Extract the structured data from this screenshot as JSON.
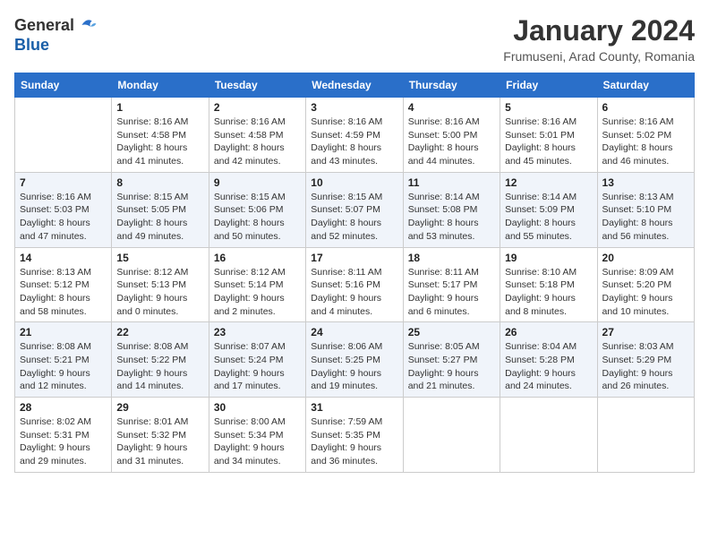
{
  "logo": {
    "text_general": "General",
    "text_blue": "Blue"
  },
  "title": "January 2024",
  "subtitle": "Frumuseni, Arad County, Romania",
  "headers": [
    "Sunday",
    "Monday",
    "Tuesday",
    "Wednesday",
    "Thursday",
    "Friday",
    "Saturday"
  ],
  "weeks": [
    [
      {
        "day": "",
        "info": ""
      },
      {
        "day": "1",
        "info": "Sunrise: 8:16 AM\nSunset: 4:58 PM\nDaylight: 8 hours\nand 41 minutes."
      },
      {
        "day": "2",
        "info": "Sunrise: 8:16 AM\nSunset: 4:58 PM\nDaylight: 8 hours\nand 42 minutes."
      },
      {
        "day": "3",
        "info": "Sunrise: 8:16 AM\nSunset: 4:59 PM\nDaylight: 8 hours\nand 43 minutes."
      },
      {
        "day": "4",
        "info": "Sunrise: 8:16 AM\nSunset: 5:00 PM\nDaylight: 8 hours\nand 44 minutes."
      },
      {
        "day": "5",
        "info": "Sunrise: 8:16 AM\nSunset: 5:01 PM\nDaylight: 8 hours\nand 45 minutes."
      },
      {
        "day": "6",
        "info": "Sunrise: 8:16 AM\nSunset: 5:02 PM\nDaylight: 8 hours\nand 46 minutes."
      }
    ],
    [
      {
        "day": "7",
        "info": "Sunrise: 8:16 AM\nSunset: 5:03 PM\nDaylight: 8 hours\nand 47 minutes."
      },
      {
        "day": "8",
        "info": "Sunrise: 8:15 AM\nSunset: 5:05 PM\nDaylight: 8 hours\nand 49 minutes."
      },
      {
        "day": "9",
        "info": "Sunrise: 8:15 AM\nSunset: 5:06 PM\nDaylight: 8 hours\nand 50 minutes."
      },
      {
        "day": "10",
        "info": "Sunrise: 8:15 AM\nSunset: 5:07 PM\nDaylight: 8 hours\nand 52 minutes."
      },
      {
        "day": "11",
        "info": "Sunrise: 8:14 AM\nSunset: 5:08 PM\nDaylight: 8 hours\nand 53 minutes."
      },
      {
        "day": "12",
        "info": "Sunrise: 8:14 AM\nSunset: 5:09 PM\nDaylight: 8 hours\nand 55 minutes."
      },
      {
        "day": "13",
        "info": "Sunrise: 8:13 AM\nSunset: 5:10 PM\nDaylight: 8 hours\nand 56 minutes."
      }
    ],
    [
      {
        "day": "14",
        "info": "Sunrise: 8:13 AM\nSunset: 5:12 PM\nDaylight: 8 hours\nand 58 minutes."
      },
      {
        "day": "15",
        "info": "Sunrise: 8:12 AM\nSunset: 5:13 PM\nDaylight: 9 hours\nand 0 minutes."
      },
      {
        "day": "16",
        "info": "Sunrise: 8:12 AM\nSunset: 5:14 PM\nDaylight: 9 hours\nand 2 minutes."
      },
      {
        "day": "17",
        "info": "Sunrise: 8:11 AM\nSunset: 5:16 PM\nDaylight: 9 hours\nand 4 minutes."
      },
      {
        "day": "18",
        "info": "Sunrise: 8:11 AM\nSunset: 5:17 PM\nDaylight: 9 hours\nand 6 minutes."
      },
      {
        "day": "19",
        "info": "Sunrise: 8:10 AM\nSunset: 5:18 PM\nDaylight: 9 hours\nand 8 minutes."
      },
      {
        "day": "20",
        "info": "Sunrise: 8:09 AM\nSunset: 5:20 PM\nDaylight: 9 hours\nand 10 minutes."
      }
    ],
    [
      {
        "day": "21",
        "info": "Sunrise: 8:08 AM\nSunset: 5:21 PM\nDaylight: 9 hours\nand 12 minutes."
      },
      {
        "day": "22",
        "info": "Sunrise: 8:08 AM\nSunset: 5:22 PM\nDaylight: 9 hours\nand 14 minutes."
      },
      {
        "day": "23",
        "info": "Sunrise: 8:07 AM\nSunset: 5:24 PM\nDaylight: 9 hours\nand 17 minutes."
      },
      {
        "day": "24",
        "info": "Sunrise: 8:06 AM\nSunset: 5:25 PM\nDaylight: 9 hours\nand 19 minutes."
      },
      {
        "day": "25",
        "info": "Sunrise: 8:05 AM\nSunset: 5:27 PM\nDaylight: 9 hours\nand 21 minutes."
      },
      {
        "day": "26",
        "info": "Sunrise: 8:04 AM\nSunset: 5:28 PM\nDaylight: 9 hours\nand 24 minutes."
      },
      {
        "day": "27",
        "info": "Sunrise: 8:03 AM\nSunset: 5:29 PM\nDaylight: 9 hours\nand 26 minutes."
      }
    ],
    [
      {
        "day": "28",
        "info": "Sunrise: 8:02 AM\nSunset: 5:31 PM\nDaylight: 9 hours\nand 29 minutes."
      },
      {
        "day": "29",
        "info": "Sunrise: 8:01 AM\nSunset: 5:32 PM\nDaylight: 9 hours\nand 31 minutes."
      },
      {
        "day": "30",
        "info": "Sunrise: 8:00 AM\nSunset: 5:34 PM\nDaylight: 9 hours\nand 34 minutes."
      },
      {
        "day": "31",
        "info": "Sunrise: 7:59 AM\nSunset: 5:35 PM\nDaylight: 9 hours\nand 36 minutes."
      },
      {
        "day": "",
        "info": ""
      },
      {
        "day": "",
        "info": ""
      },
      {
        "day": "",
        "info": ""
      }
    ]
  ]
}
